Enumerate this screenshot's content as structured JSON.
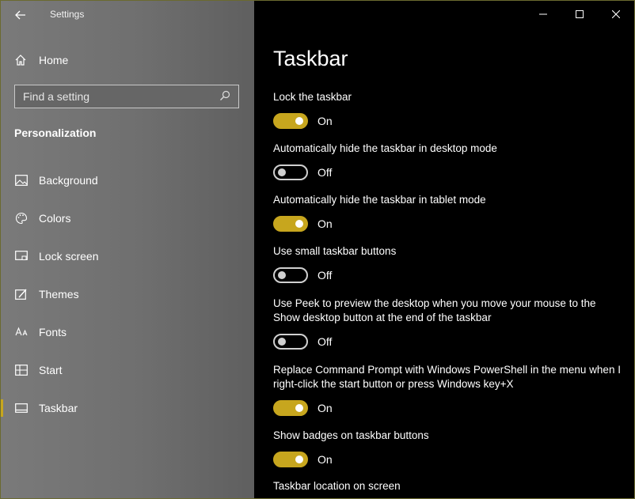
{
  "app": {
    "title": "Settings"
  },
  "sidebar": {
    "home_label": "Home",
    "search_placeholder": "Find a setting",
    "section_title": "Personalization",
    "items": [
      {
        "label": "Background",
        "icon": "image-icon"
      },
      {
        "label": "Colors",
        "icon": "palette-icon"
      },
      {
        "label": "Lock screen",
        "icon": "lock-screen-icon"
      },
      {
        "label": "Themes",
        "icon": "themes-icon"
      },
      {
        "label": "Fonts",
        "icon": "fonts-icon"
      },
      {
        "label": "Start",
        "icon": "start-icon"
      },
      {
        "label": "Taskbar",
        "icon": "taskbar-icon",
        "active": true
      }
    ]
  },
  "main": {
    "title": "Taskbar",
    "settings": [
      {
        "label": "Lock the taskbar",
        "state": "On"
      },
      {
        "label": "Automatically hide the taskbar in desktop mode",
        "state": "Off"
      },
      {
        "label": "Automatically hide the taskbar in tablet mode",
        "state": "On"
      },
      {
        "label": "Use small taskbar buttons",
        "state": "Off"
      },
      {
        "label": "Use Peek to preview the desktop when you move your mouse to the Show desktop button at the end of the taskbar",
        "state": "Off"
      },
      {
        "label": "Replace Command Prompt with Windows PowerShell in the menu when I right-click the start button or press Windows key+X",
        "state": "On"
      },
      {
        "label": "Show badges on taskbar buttons",
        "state": "On"
      }
    ],
    "next_section_label": "Taskbar location on screen"
  },
  "colors": {
    "accent": "#c7a61e",
    "sidebar_bg": "#737373",
    "main_bg": "#000000"
  }
}
